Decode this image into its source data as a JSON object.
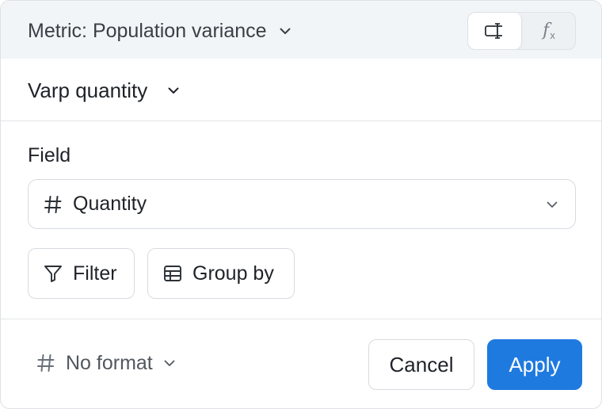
{
  "header": {
    "metric_label": "Metric: Population variance",
    "mode_toggle": {
      "selected": "column-editor",
      "options": [
        {
          "name": "column-editor-icon"
        },
        {
          "name": "formula-icon",
          "glyph": "f",
          "sub": "x"
        }
      ]
    }
  },
  "name": {
    "label": "Varp quantity"
  },
  "field": {
    "label": "Field",
    "type_icon": "hash-icon",
    "value": "Quantity"
  },
  "chips": {
    "filter_label": "Filter",
    "group_by_label": "Group by"
  },
  "footer": {
    "format_label": "No format",
    "cancel_label": "Cancel",
    "apply_label": "Apply"
  },
  "colors": {
    "accent": "#1f7ae0",
    "header_bg": "#f2f5f8",
    "border": "#d7dbe0"
  }
}
